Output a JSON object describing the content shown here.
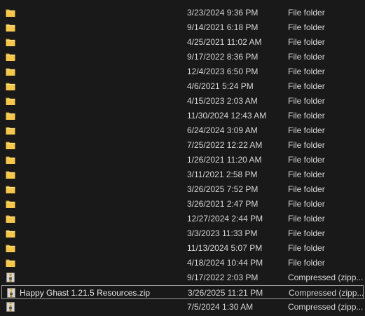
{
  "files": [
    {
      "name": "",
      "date": "3/23/2024 9:36 PM",
      "type": "File folder",
      "icon": "folder-icon"
    },
    {
      "name": "",
      "date": "9/14/2021 6:18 PM",
      "type": "File folder",
      "icon": "folder-icon"
    },
    {
      "name": "",
      "date": "4/25/2021 11:02 AM",
      "type": "File folder",
      "icon": "folder-icon"
    },
    {
      "name": "",
      "date": "9/17/2022 8:36 PM",
      "type": "File folder",
      "icon": "folder-icon"
    },
    {
      "name": "",
      "date": "12/4/2023 6:50 PM",
      "type": "File folder",
      "icon": "folder-icon"
    },
    {
      "name": "",
      "date": "4/6/2021 5:24 PM",
      "type": "File folder",
      "icon": "folder-icon"
    },
    {
      "name": "",
      "date": "4/15/2023 2:03 AM",
      "type": "File folder",
      "icon": "folder-icon"
    },
    {
      "name": "",
      "date": "11/30/2024 12:43 AM",
      "type": "File folder",
      "icon": "folder-icon"
    },
    {
      "name": "",
      "date": "6/24/2024 3:09 AM",
      "type": "File folder",
      "icon": "folder-icon"
    },
    {
      "name": "",
      "date": "7/25/2022 12:22 AM",
      "type": "File folder",
      "icon": "folder-icon"
    },
    {
      "name": "",
      "date": "1/26/2021 11:20 AM",
      "type": "File folder",
      "icon": "folder-icon"
    },
    {
      "name": "",
      "date": "3/11/2021 2:58 PM",
      "type": "File folder",
      "icon": "folder-icon"
    },
    {
      "name": "",
      "date": "3/26/2025 7:52 PM",
      "type": "File folder",
      "icon": "folder-icon"
    },
    {
      "name": "",
      "date": "3/26/2021 2:47 PM",
      "type": "File folder",
      "icon": "folder-icon"
    },
    {
      "name": "",
      "date": "12/27/2024 2:44 PM",
      "type": "File folder",
      "icon": "folder-icon"
    },
    {
      "name": "",
      "date": "3/3/2023 11:33 PM",
      "type": "File folder",
      "icon": "folder-icon"
    },
    {
      "name": "",
      "date": "11/13/2024 5:07 PM",
      "type": "File folder",
      "icon": "folder-icon"
    },
    {
      "name": "",
      "date": "4/18/2024 10:44 PM",
      "type": "File folder",
      "icon": "folder-icon"
    },
    {
      "name": "",
      "date": "9/17/2022 2:03 PM",
      "type": "Compressed (zipp...",
      "icon": "zip-icon"
    },
    {
      "name": "Happy Ghast 1.21.5 Resources.zip",
      "date": "3/26/2025 11:21 PM",
      "type": "Compressed (zipp...",
      "icon": "zip-icon",
      "selected": true
    },
    {
      "name": "",
      "date": "7/5/2024 1:30 AM",
      "type": "Compressed (zipp...",
      "icon": "zip-icon"
    }
  ]
}
